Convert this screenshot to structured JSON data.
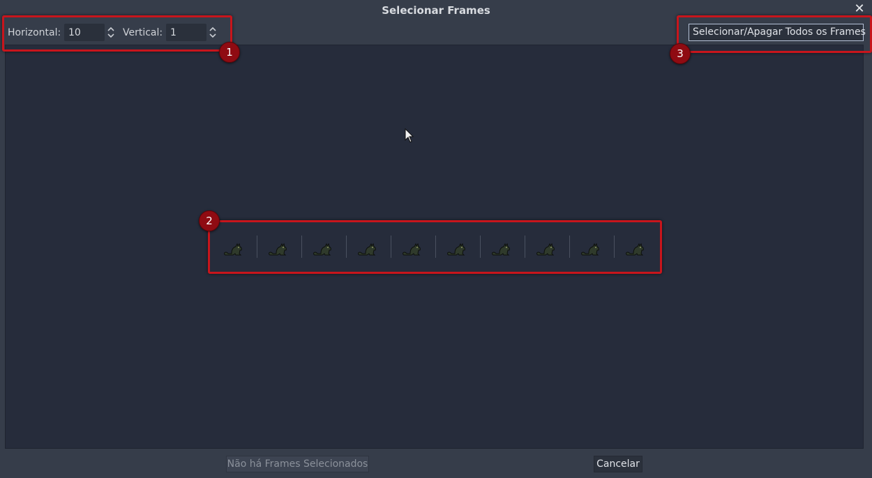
{
  "dialog": {
    "title": "Selecionar Frames"
  },
  "toolbar": {
    "horizontal_label": "Horizontal:",
    "horizontal_value": "10",
    "vertical_label": "Vertical:",
    "vertical_value": "1",
    "select_all_label": "Selecionar/Apagar Todos os Frames"
  },
  "frames": {
    "count": 10,
    "icon": "cat-sprite-icon"
  },
  "annotations": {
    "badge_1": "1",
    "badge_2": "2",
    "badge_3": "3",
    "color": "#c8151c"
  },
  "footer": {
    "none_selected_label": "Não há Frames Selecionados",
    "cancel_label": "Cancelar"
  },
  "colors": {
    "background": "#363d4a",
    "content": "#262c3b",
    "annotation": "#c8151c",
    "badge": "#8f0b12"
  }
}
